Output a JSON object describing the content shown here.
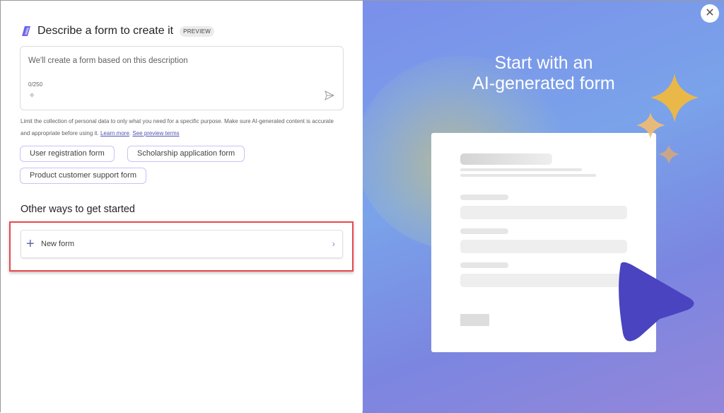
{
  "dialog": {
    "title": "Describe a form to create it",
    "badge": "PREVIEW",
    "description_input": {
      "placeholder": "We'll create a form based on this description",
      "value": "",
      "char_count": "0/250"
    },
    "notice": "Limit the collection of personal data to only what you need for a specific purpose. Make sure AI-generated content is accurate and appropriate before using it.",
    "learn_more": "Learn more",
    "preview_terms": "See preview terms",
    "suggestions": [
      "User registration form",
      "Scholarship application form",
      "Product customer support form"
    ],
    "other_ways_heading": "Other ways to get started",
    "new_form_label": "New form"
  },
  "promo": {
    "headline_line1": "Start with an",
    "headline_line2": "AI-generated form"
  },
  "colors": {
    "accent": "#6264a7",
    "highlight": "#e84a4f",
    "promo_play": "#4a44c0",
    "sparkle": "#f0b840"
  }
}
